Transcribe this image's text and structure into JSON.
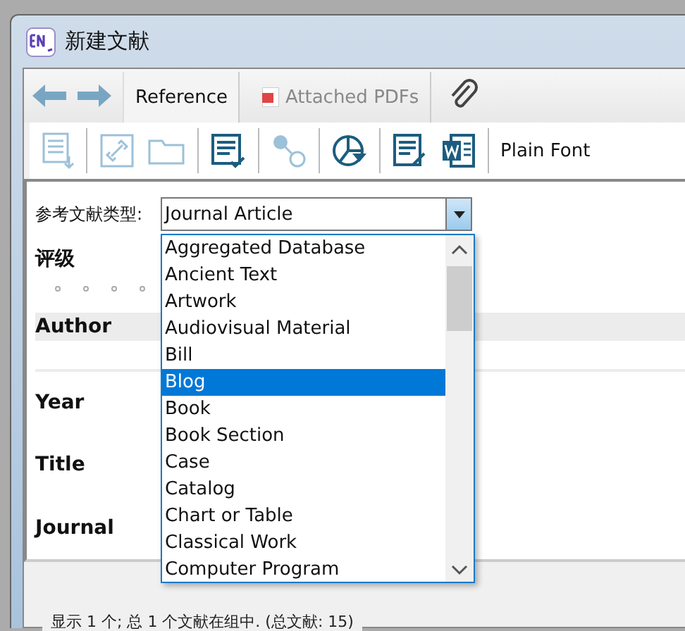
{
  "window": {
    "title": "新建文献"
  },
  "tabs": [
    {
      "label": "Reference",
      "selected": true
    },
    {
      "label": "Attached PDFs",
      "selected": false
    }
  ],
  "toolbar": {
    "font_label": "Plain Font"
  },
  "reference_type": {
    "label": "参考文献类型:",
    "value": "Journal Article",
    "expanded": true,
    "options": [
      {
        "label": "Aggregated Database",
        "selected": false
      },
      {
        "label": "Ancient Text",
        "selected": false
      },
      {
        "label": "Artwork",
        "selected": false
      },
      {
        "label": "Audiovisual Material",
        "selected": false
      },
      {
        "label": "Bill",
        "selected": false
      },
      {
        "label": "Blog",
        "selected": true
      },
      {
        "label": "Book",
        "selected": false
      },
      {
        "label": "Book Section",
        "selected": false
      },
      {
        "label": "Case",
        "selected": false
      },
      {
        "label": "Catalog",
        "selected": false
      },
      {
        "label": "Chart or Table",
        "selected": false
      },
      {
        "label": "Classical Work",
        "selected": false
      },
      {
        "label": "Computer Program",
        "selected": false
      }
    ]
  },
  "rating": {
    "label": "评级",
    "stars": 0
  },
  "fields": [
    {
      "label": "Author"
    },
    {
      "label": "Year"
    },
    {
      "label": "Title"
    },
    {
      "label": "Journal"
    }
  ],
  "status_bar": "显示 1 个; 总 1 个文献在组中. (总文献: 15)"
}
